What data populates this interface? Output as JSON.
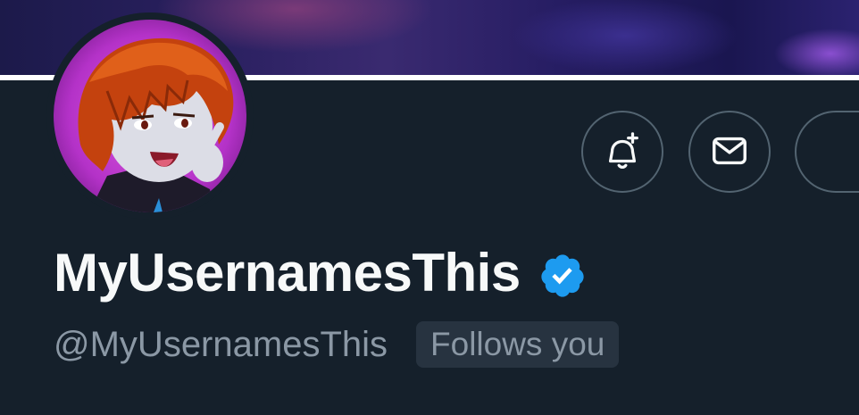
{
  "profile": {
    "display_name": "MyUsernamesThis",
    "handle": "@MyUsernamesThis",
    "follows_you_badge": "Follows you",
    "verified": true
  },
  "actions": {
    "notifications_icon": "bell-plus-icon",
    "message_icon": "envelope-icon"
  },
  "colors": {
    "background": "#15202b",
    "primary_text": "#f7f9f9",
    "secondary_text": "#8b98a5",
    "verified_blue": "#1d9bf0",
    "button_border": "#536471",
    "badge_background": "#273340"
  }
}
